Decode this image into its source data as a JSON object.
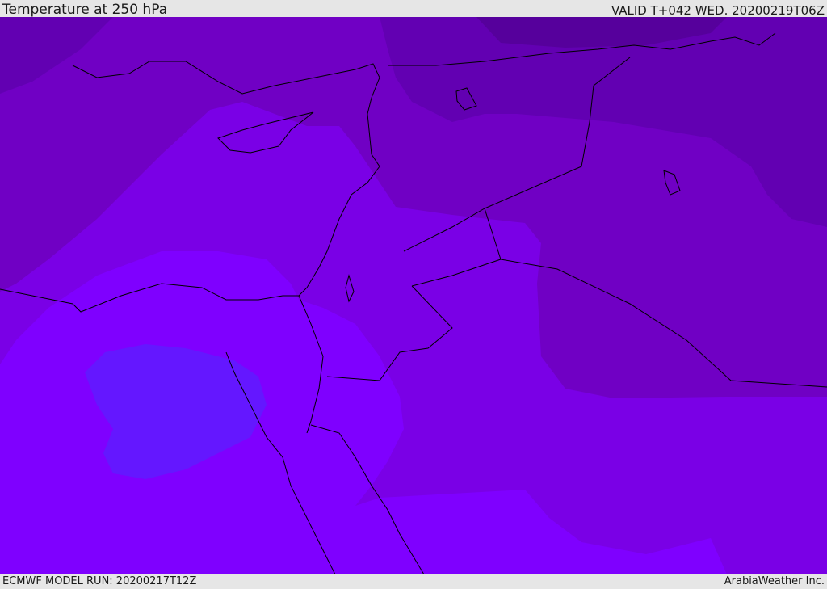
{
  "header": {
    "title": "Temperature at 250 hPa",
    "valid": "VALID T+042 WED. 20200219T06Z"
  },
  "footer": {
    "model_run": "ECMWF MODEL RUN: 20200217T12Z",
    "credit": "ArabiaWeather Inc."
  },
  "map": {
    "colors": {
      "band_darkest": "#56009c",
      "band_dark": "#6200b2",
      "band_mid": "#7000c4",
      "band_base": "#7a00e6",
      "band_light": "#7f00ff",
      "band_lightest": "#6417ff",
      "coastline": "#000000"
    }
  }
}
